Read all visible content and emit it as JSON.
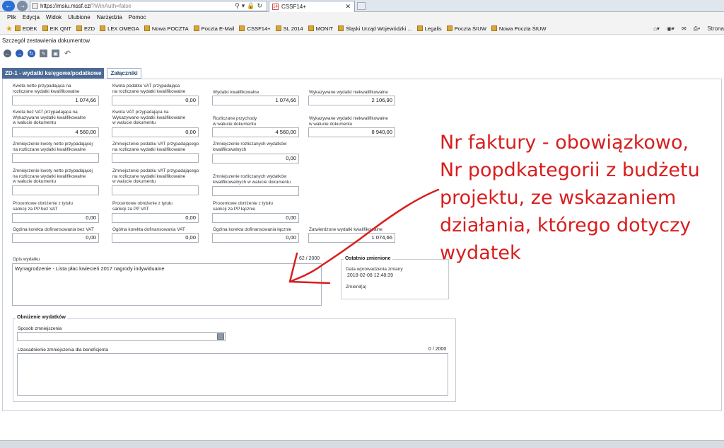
{
  "browser": {
    "url_main": "https://msiu.mssf.cz/",
    "url_rest": "?WinAuth=false",
    "tab_title": "CSSF14+",
    "tab_favicon": "14",
    "menu": [
      "Plik",
      "Edycja",
      "Widok",
      "Ulubione",
      "Narzędzia",
      "Pomoc"
    ],
    "favorites": [
      "EDEK",
      "EIK QNT",
      "EZD",
      "LEX OMEGA",
      "Nowa POCZTA",
      "Poczta E-Mail",
      "CSSF14+",
      "SL 2014",
      "MONIT",
      "Śląski Urząd Wojewódzki ...",
      "Legalis",
      "Poczta ŚIUW",
      "Nowa Poczta ŚIUW"
    ],
    "fav_tools_last": "Strona"
  },
  "page": {
    "title": "Szczegół zestawienia dokumentow"
  },
  "tabs": {
    "active": "ZD-1 - wydatki księgowe/podatkowe",
    "second": "Załączniki"
  },
  "fields": {
    "f1": {
      "label": "Kwota netto przypadająca na\nrozliczane wydatki kwalifikowalne",
      "value": "1 074,66"
    },
    "f2": {
      "label": "Kwota podatku VAT przypadająca\nna rozliczane wydatki kwalifikowalne",
      "value": "0,00"
    },
    "f3": {
      "label": "Wydatki kwalifikowalne",
      "value": "1 074,66"
    },
    "f4": {
      "label": "Wykazywane wydatki niekwalifikowalne",
      "value": "2 106,90"
    },
    "f5": {
      "label": "Kwota bez VAT przypadająca na\nWykazywane wydatki kwalifikowalne\nw walucie dokumentu",
      "value": "4 560,00"
    },
    "f6": {
      "label": "Kwota VAT przypadająca na\nWykazywane wydatki kwalifikowalne\nw walucie dokumentu",
      "value": "0,00"
    },
    "f7": {
      "label": "Rozliczane przychody\nw walucie dokumentu",
      "value": "4 560,00"
    },
    "f8": {
      "label": "Wykazywane wydatki niekwalifikowalne\nw walucie dokumentu",
      "value": "8 940,00"
    },
    "f9": {
      "label": "Zmniejszenie kwoty netto przypadającej\nna rozliczane wydatki kwalifikowalne",
      "value": ""
    },
    "f10": {
      "label": "Zmniejszenie podatku VAT przypadającego\nna rozliczane wydatki kwalifikowalne",
      "value": ""
    },
    "f11": {
      "label": "Zmniejszenie rozliczanych wydatków\nkwalifikowalnych",
      "value": "0,00"
    },
    "f12": {
      "label": "Zmniejszenie kwoty netto przypadającej\nna rozliczane wydatki kwalifikowalne\nw walucie dokumentu",
      "value": ""
    },
    "f13": {
      "label": "Zmniejszenie podatku VAT przypadającego\nna rozliczane wydatki kwalifikowalne\nw walucie dokumentu",
      "value": ""
    },
    "f14": {
      "label": "Zmniejszenie rozliczanych wydatków\nkwalifikowalnych w walucie dokumentu",
      "value": ""
    },
    "f15": {
      "label": "Procentowe obniżenie z tytułu\nsankcji za PP bez VAT",
      "value": "0,00"
    },
    "f16": {
      "label": "Procentowe obniżenie z tytułu\nsankcji za PP VAT",
      "value": "0,00"
    },
    "f17": {
      "label": "Procentowe obniżenie z tytułu\nsankcji za PP łącznie",
      "value": "0,00"
    },
    "f18": {
      "label": "Ogólna korekta dofinansowania bez VAT",
      "value": "0,00"
    },
    "f19": {
      "label": "Ogólna korekta dofinansowania VAT",
      "value": "0,00"
    },
    "f20": {
      "label": "Ogólna korekta dofinansowania łącznie",
      "value": "0,00"
    },
    "f21": {
      "label": "Zatwierdzone wydatki kwalifikowalne",
      "value": "1 074,66"
    }
  },
  "opis": {
    "label": "Opis wydatku",
    "counter": "62 / 2000",
    "value": "Wynagrodzenie - Lista płac kwiecień 2017 nagrody indywiduaine"
  },
  "ostatnio": {
    "title": "Ostatnio zmienione",
    "date_label": "Data wprowadzenia zmiany",
    "date_value": "2018-02-08 12:48:39",
    "changed_label": "Zmienił(a)"
  },
  "obnizenie": {
    "title": "Obniżenie wydatków",
    "sposob_label": "Sposób zmniejszenia",
    "uzas_label": "Uzasadnienie zmniejszenia dla beneficjenta",
    "uzas_counter": "0 / 2000"
  },
  "annotation": {
    "lines": [
      "Nr faktury - obowiązkowo,",
      "Nr popdkategorii z budżetu",
      "projektu, ze wskazaniem",
      "działania, którego dotyczy",
      "wydatek"
    ],
    "color": "#d81e1e"
  }
}
